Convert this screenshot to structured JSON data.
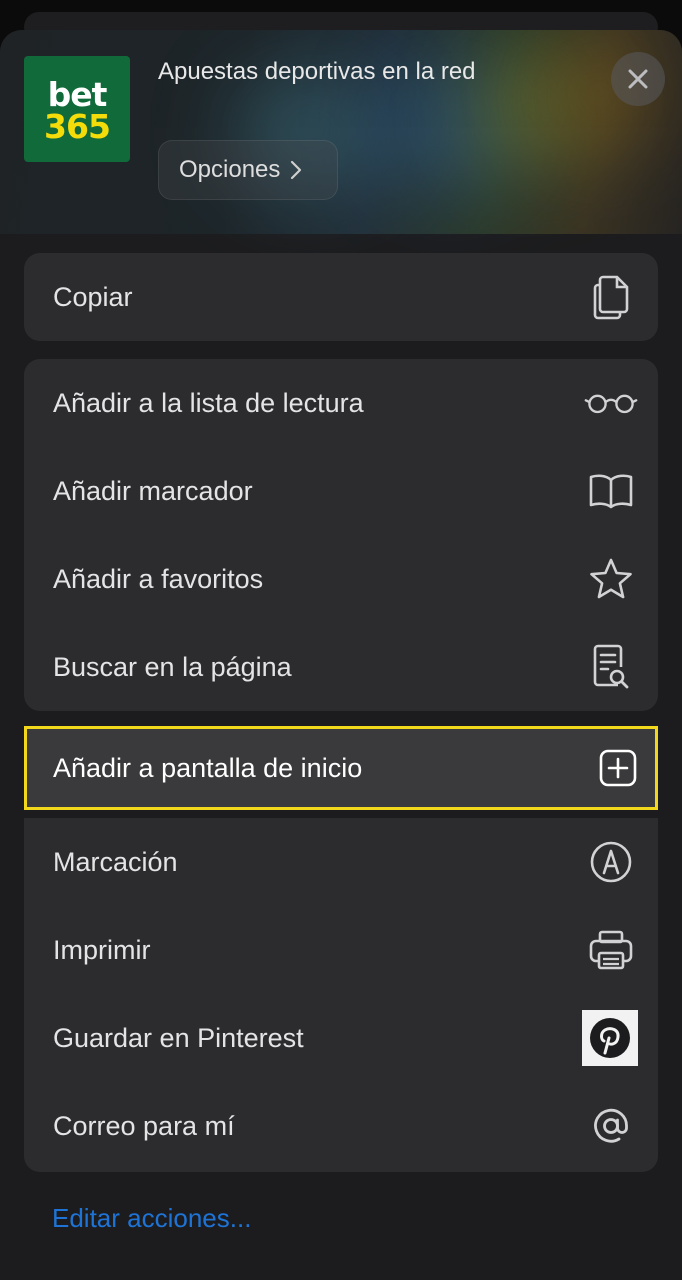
{
  "header": {
    "logo": {
      "line1": "bet",
      "line2": "365",
      "bg_color": "#116a3a",
      "accent_color": "#f4dc0a"
    },
    "title": "Apuestas deportivas en la red",
    "options_label": "Opciones",
    "options_chevron_icon": "chevron-right-icon",
    "close_icon": "close-icon"
  },
  "actions": {
    "copy": {
      "label": "Copiar",
      "icon": "copy-icon"
    },
    "group2": [
      {
        "label": "Añadir a la lista de lectura",
        "icon": "glasses-icon"
      },
      {
        "label": "Añadir marcador",
        "icon": "book-icon"
      },
      {
        "label": "Añadir a favoritos",
        "icon": "star-icon"
      },
      {
        "label": "Buscar en la página",
        "icon": "find-in-page-icon"
      }
    ],
    "highlighted": {
      "label": "Añadir a pantalla de inicio",
      "icon": "add-square-icon",
      "border_color": "#f2d81d"
    },
    "group3": [
      {
        "label": "Marcación",
        "icon": "markup-icon"
      },
      {
        "label": "Imprimir",
        "icon": "printer-icon"
      },
      {
        "label": "Guardar en Pinterest",
        "icon": "pinterest-icon"
      },
      {
        "label": "Correo para mí",
        "icon": "at-sign-icon"
      }
    ]
  },
  "footer": {
    "edit_label": "Editar acciones...",
    "link_color": "#1e74d6"
  }
}
